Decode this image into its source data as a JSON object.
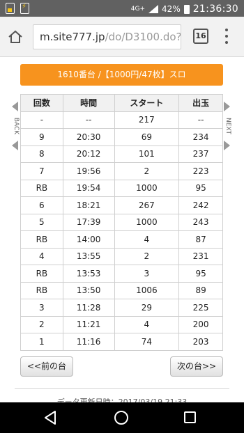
{
  "status_bar": {
    "network": "4G+",
    "battery": "42%",
    "time": "21:36:30",
    "icons": [
      "sim-icon",
      "battery-saver-icon",
      "signal-icon",
      "battery-icon"
    ]
  },
  "browser": {
    "url_host": "m.site777.jp",
    "url_path": "/do/D3100.do?p",
    "tab_count": "16",
    "icons": [
      "home-icon",
      "overflow-menu-icon"
    ]
  },
  "banner": {
    "text": "1610番台 /【1000円/47枚】スロ",
    "color": "#f7931e"
  },
  "side_nav": {
    "back_label": "BACK",
    "next_label": "NEXT"
  },
  "table": {
    "headers": [
      "回数",
      "時間",
      "スタート",
      "出玉"
    ],
    "rows": [
      [
        "-",
        "--",
        "217",
        "--"
      ],
      [
        "9",
        "20:30",
        "69",
        "234"
      ],
      [
        "8",
        "20:12",
        "101",
        "237"
      ],
      [
        "7",
        "19:56",
        "2",
        "223"
      ],
      [
        "RB",
        "19:54",
        "1000",
        "95"
      ],
      [
        "6",
        "18:21",
        "267",
        "242"
      ],
      [
        "5",
        "17:39",
        "1000",
        "243"
      ],
      [
        "RB",
        "14:00",
        "4",
        "87"
      ],
      [
        "4",
        "13:55",
        "2",
        "231"
      ],
      [
        "RB",
        "13:53",
        "3",
        "95"
      ],
      [
        "RB",
        "13:50",
        "1006",
        "89"
      ],
      [
        "3",
        "11:28",
        "29",
        "225"
      ],
      [
        "2",
        "11:21",
        "4",
        "200"
      ],
      [
        "1",
        "11:16",
        "74",
        "203"
      ]
    ]
  },
  "pager": {
    "prev_label": "<<前の台",
    "next_label": "次の台>>"
  },
  "footer": {
    "partial_text": "データ更新日時：2017/03/19 21:33"
  },
  "system_nav": {
    "icons": [
      "back-icon",
      "home-icon",
      "recents-icon"
    ]
  }
}
